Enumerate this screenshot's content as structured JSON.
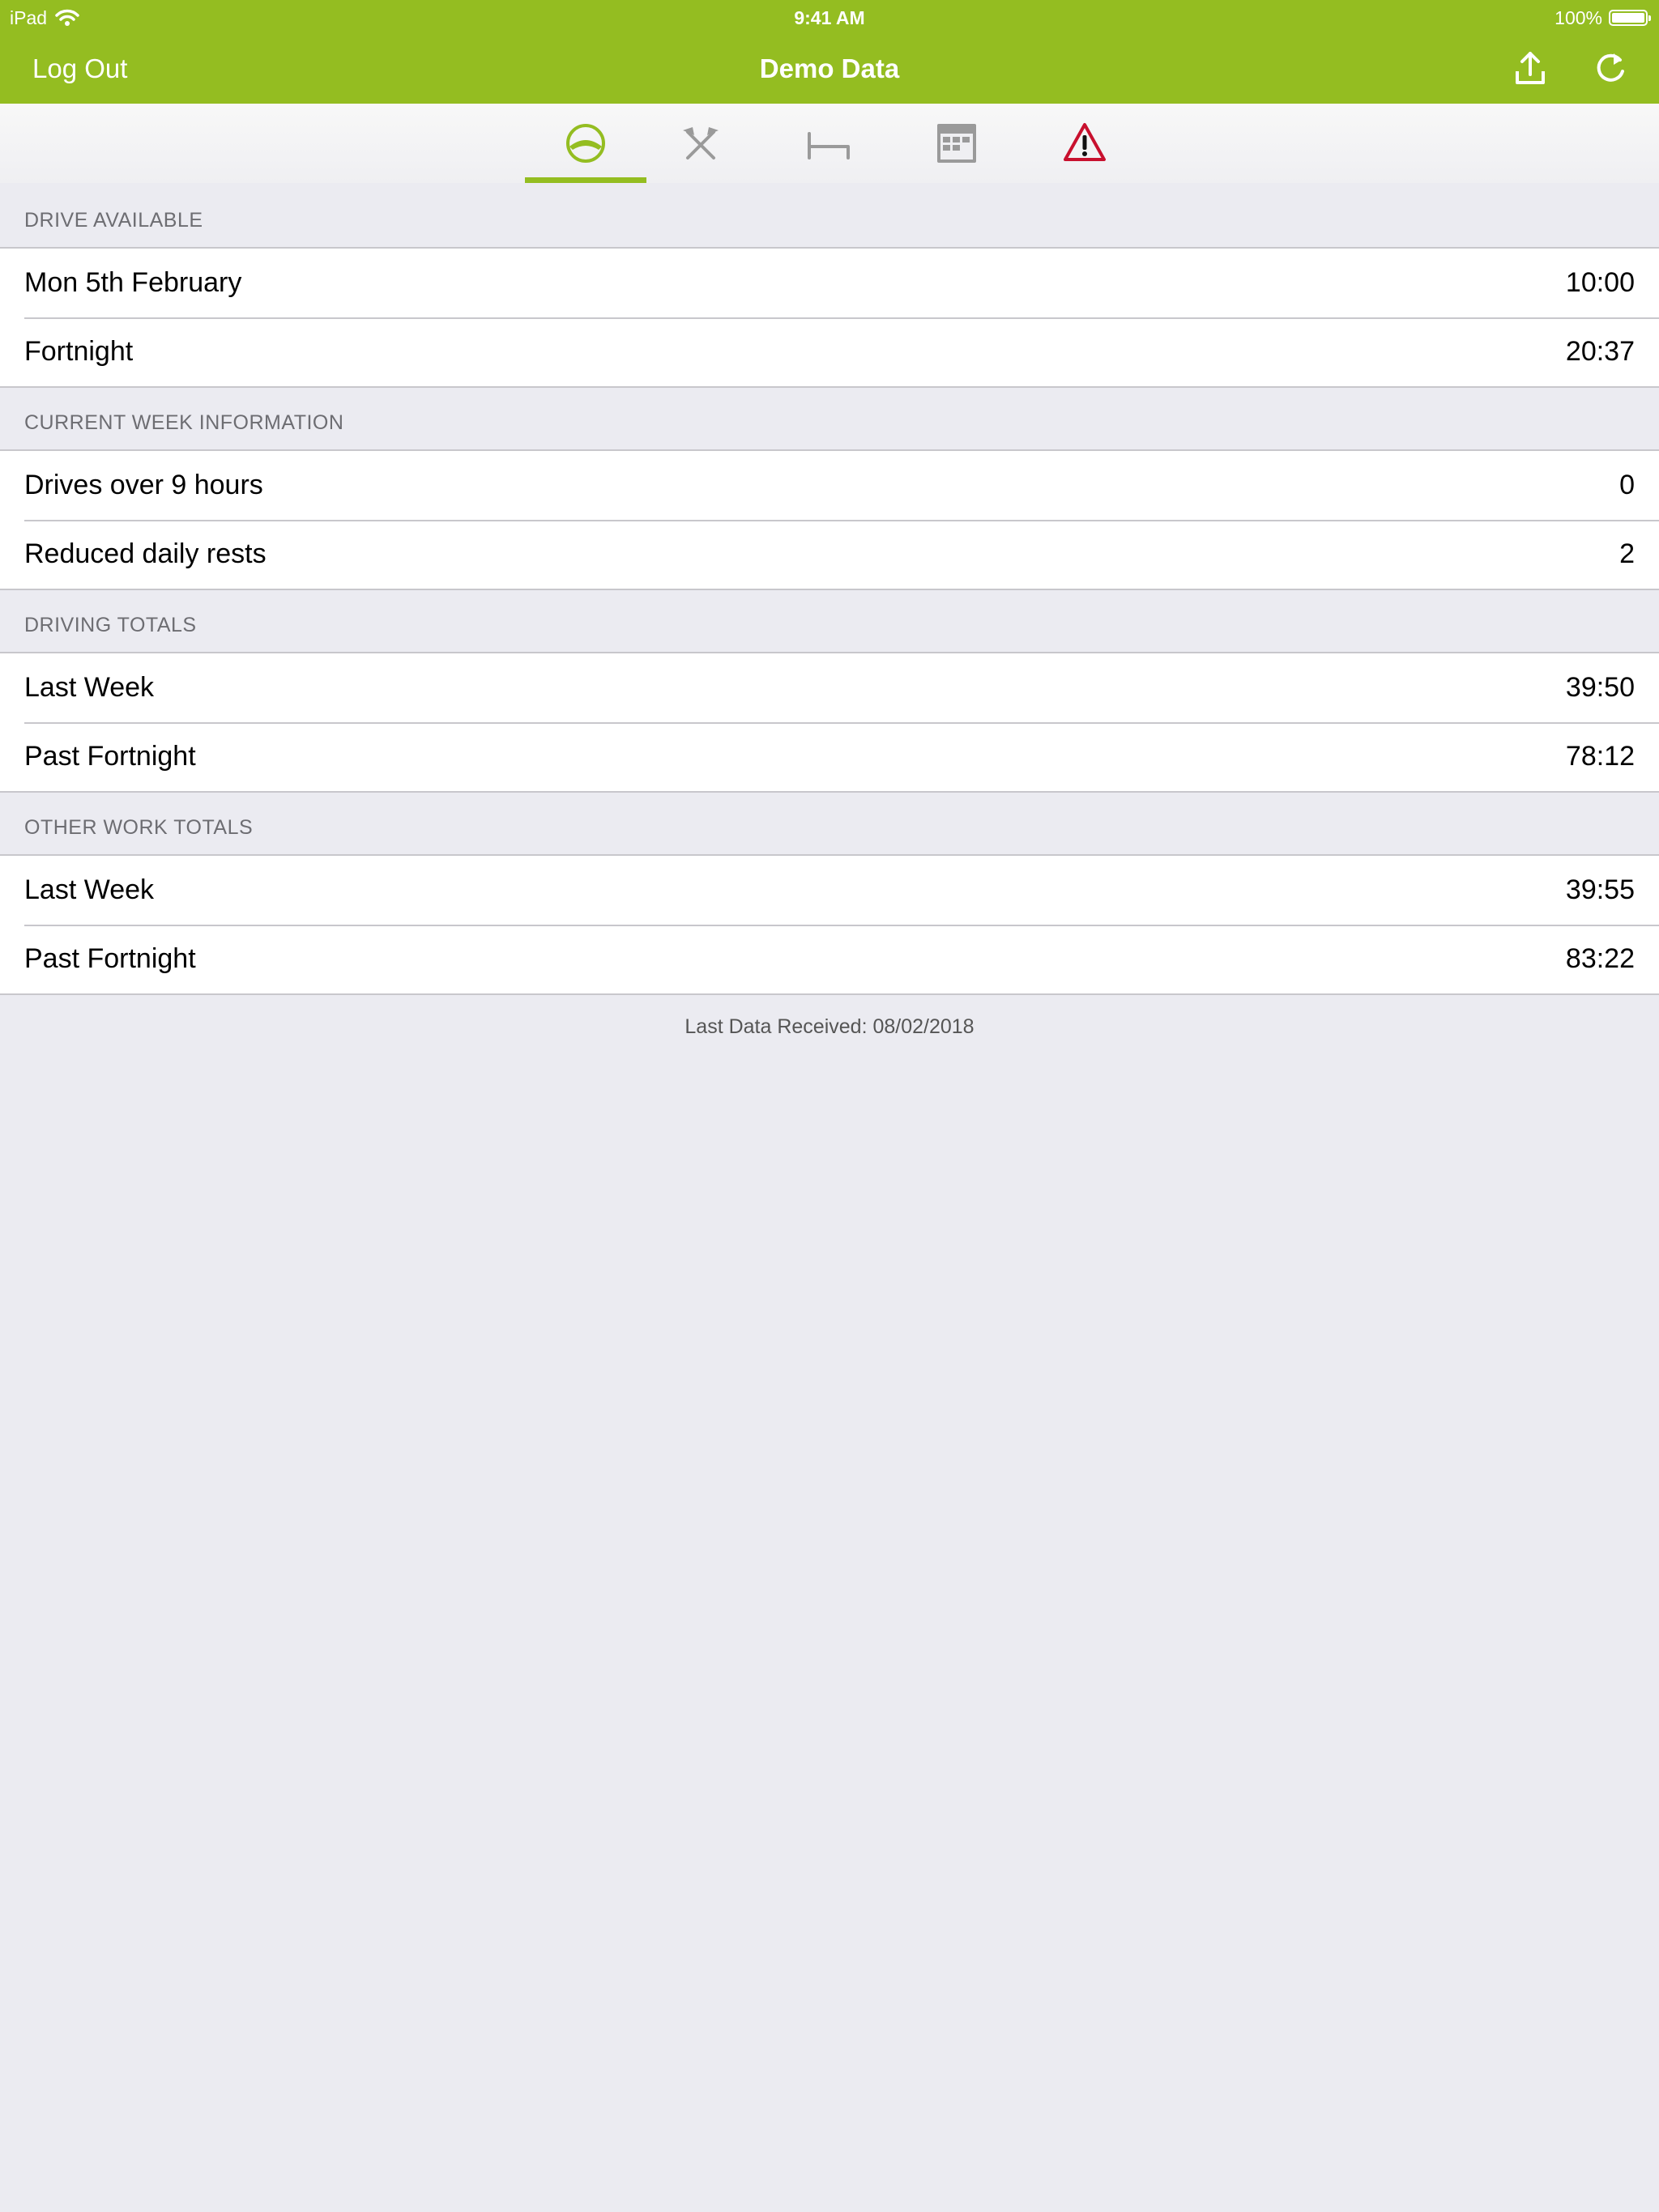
{
  "status_bar": {
    "device": "iPad",
    "time": "9:41 AM",
    "battery": "100%",
    "battery_level": 1.0
  },
  "nav": {
    "left_label": "Log Out",
    "title": "Demo Data",
    "right_icons": [
      "upload-icon",
      "refresh-icon"
    ]
  },
  "colors": {
    "accent": "#94bd21",
    "warning": "#c8102e",
    "background": "#ebebf1"
  },
  "tabs": [
    {
      "name": "steering-wheel-icon",
      "active": true
    },
    {
      "name": "crossed-hammers-icon",
      "active": false
    },
    {
      "name": "bed-icon",
      "active": false
    },
    {
      "name": "calendar-icon",
      "active": false
    },
    {
      "name": "warning-icon",
      "active": false
    }
  ],
  "sections": [
    {
      "header": "DRIVE AVAILABLE",
      "rows": [
        {
          "label": "Mon 5th February",
          "value": "10:00"
        },
        {
          "label": "Fortnight",
          "value": "20:37"
        }
      ]
    },
    {
      "header": "CURRENT WEEK INFORMATION",
      "rows": [
        {
          "label": "Drives over 9 hours",
          "value": "0"
        },
        {
          "label": "Reduced daily rests",
          "value": "2"
        }
      ]
    },
    {
      "header": "DRIVING TOTALS",
      "rows": [
        {
          "label": "Last Week",
          "value": "39:50"
        },
        {
          "label": "Past Fortnight",
          "value": "78:12"
        }
      ]
    },
    {
      "header": "OTHER WORK TOTALS",
      "rows": [
        {
          "label": "Last Week",
          "value": "39:55"
        },
        {
          "label": "Past Fortnight",
          "value": "83:22"
        }
      ]
    }
  ],
  "footer": "Last Data Received: 08/02/2018"
}
